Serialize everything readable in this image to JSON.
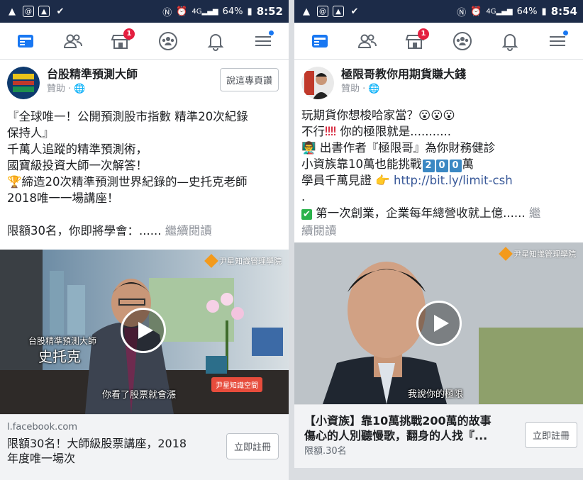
{
  "status_left": {
    "time": "8:52",
    "battery": "64%",
    "signal": "4G"
  },
  "status_right": {
    "time": "8:54",
    "battery": "64%",
    "signal": "4G"
  },
  "nav": {
    "items": [
      {
        "name": "news-feed-icon"
      },
      {
        "name": "friends-icon"
      },
      {
        "name": "marketplace-icon",
        "badge": "1"
      },
      {
        "name": "groups-icon"
      },
      {
        "name": "notifications-icon"
      },
      {
        "name": "menu-icon"
      }
    ]
  },
  "post1": {
    "page_name": "台股精準預測大師",
    "sponsored": "贊助 ·",
    "like_button": "說這專頁讚",
    "text_lines": [
      "『全球唯一！公開預測股市指數 精準20次紀錄",
      "保持人』",
      "千萬人追蹤的精準預測術，",
      "國寶級投資大師一次解答！",
      "締造20次精準預測世界紀錄的—史托克老師",
      "2018唯一一場講座！",
      "",
      "限額30名，你即將學會：......"
    ],
    "see_more": "繼續閱讀",
    "video": {
      "watermark": "尹星知識管理學院",
      "caption_title": "台股精準預測大師",
      "caption_name": "史托克",
      "subtitle": "你看了股票就會漲",
      "mic_label": "尹星知識空間"
    },
    "link": {
      "domain": "l.facebook.com",
      "title": "限額30名！大師級股票講座，2018",
      "title2": "年度唯一場次",
      "cta": "立即註冊"
    }
  },
  "post2": {
    "page_name": "極限哥教你用期貨賺大錢",
    "sponsored": "贊助 ·",
    "line1": "玩期貨你想梭哈家當？",
    "line2_a": "不行",
    "line2_b": " 你的極限就是...........",
    "line3": " 出書作者『極限哥』為你財務健診",
    "line4_a": "小資族靠10萬也能挑戰",
    "digits": [
      "2",
      "0",
      "0"
    ],
    "line4_b": "萬",
    "line5_a": "學員千萬見證 ",
    "line5_link": "http://bit.ly/limit-csh",
    "line6": ".",
    "line7": " 第一次創業，企業每年總營收就上億......",
    "see_more_a": "繼",
    "see_more_b": "續閱讀",
    "video": {
      "watermark": "尹星知識管理學院",
      "subtitle": "我說你的極限"
    },
    "link": {
      "title": "【小資族】靠10萬挑戰200萬的故事",
      "title2": "傷心的人別聽慢歌，翻身的人找『...",
      "sub": "限額.30名",
      "cta": "立即註冊"
    }
  },
  "colors": {
    "status_bar": "#1c2b48",
    "accent": "#1877f2",
    "badge": "#e41e3f"
  }
}
